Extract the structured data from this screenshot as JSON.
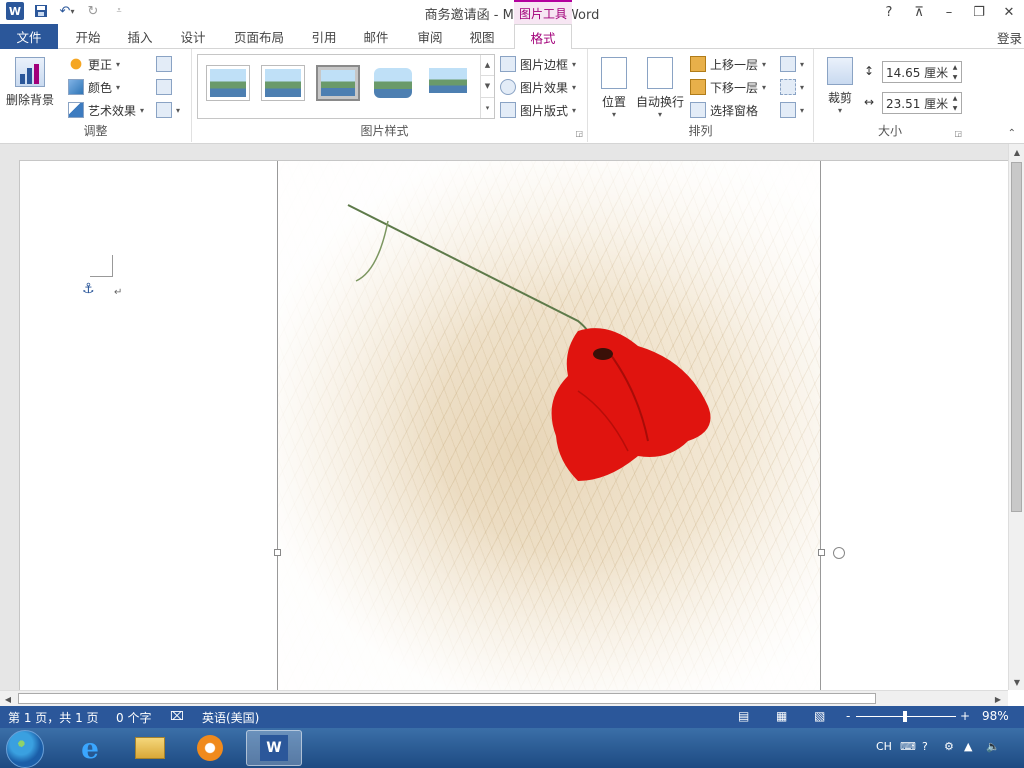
{
  "titlebar": {
    "doc_title": "商务邀请函 - Microsoft Word",
    "context_group": "图片工具",
    "help": "?",
    "ribbon_display": "⊼",
    "minimize": "–",
    "restore": "❐",
    "close": "✕"
  },
  "tabs": {
    "file": "文件",
    "home": "开始",
    "insert": "插入",
    "design": "设计",
    "layout": "页面布局",
    "references": "引用",
    "mailings": "邮件",
    "review": "审阅",
    "view": "视图",
    "format": "格式",
    "login": "登录"
  },
  "ribbon": {
    "adjust": {
      "label": "调整",
      "remove_bg": "删除背景",
      "corrections": "更正",
      "color": "颜色",
      "artistic": "艺术效果"
    },
    "styles": {
      "label": "图片样式",
      "border": "图片边框",
      "effects": "图片效果",
      "layout": "图片版式"
    },
    "arrange": {
      "label": "排列",
      "position": "位置",
      "wrap": "自动换行",
      "bring_forward": "上移一层",
      "send_backward": "下移一层",
      "selection_pane": "选择窗格"
    },
    "size": {
      "label": "大小",
      "crop": "裁剪",
      "height": "14.65 厘米",
      "width": "23.51 厘米"
    }
  },
  "statusbar": {
    "page": "第 1 页，共 1 页",
    "words": "0 个字",
    "language": "英语(美国)",
    "zoom_out": "-",
    "zoom_in": "+",
    "zoom": "98%"
  },
  "tray": {
    "lang": "CH"
  },
  "colors": {
    "accent": "#2b579a",
    "context_accent": "#a2007a",
    "poppy": "#e0140f"
  }
}
